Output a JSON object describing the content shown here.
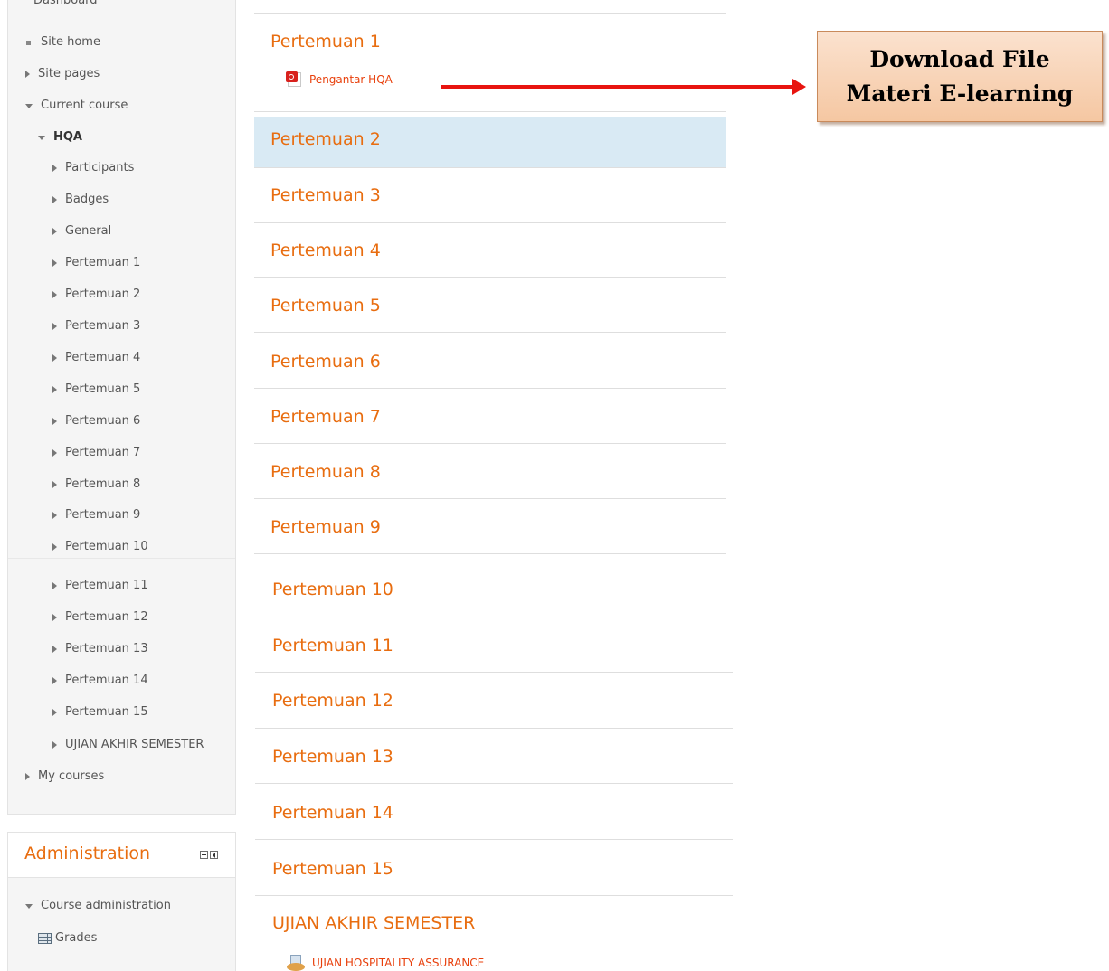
{
  "navigation": {
    "cut_item": "Dashboard",
    "items": [
      {
        "label": "Site home",
        "marker": "bullet",
        "bold": false
      },
      {
        "label": "Site pages",
        "marker": "collapsed",
        "bold": false
      },
      {
        "label": "Current course",
        "marker": "expanded",
        "bold": false
      },
      {
        "label": "HQA",
        "marker": "expanded",
        "bold": true
      },
      {
        "label": "Participants",
        "marker": "collapsed",
        "bold": false
      },
      {
        "label": "Badges",
        "marker": "collapsed",
        "bold": false
      },
      {
        "label": "General",
        "marker": "collapsed",
        "bold": false
      },
      {
        "label": "Pertemuan 1",
        "marker": "collapsed",
        "bold": false
      },
      {
        "label": "Pertemuan 2",
        "marker": "collapsed",
        "bold": false
      },
      {
        "label": "Pertemuan 3",
        "marker": "collapsed",
        "bold": false
      },
      {
        "label": "Pertemuan 4",
        "marker": "collapsed",
        "bold": false
      },
      {
        "label": "Pertemuan 5",
        "marker": "collapsed",
        "bold": false
      },
      {
        "label": "Pertemuan 6",
        "marker": "collapsed",
        "bold": false
      },
      {
        "label": "Pertemuan 7",
        "marker": "collapsed",
        "bold": false
      },
      {
        "label": "Pertemuan 8",
        "marker": "collapsed",
        "bold": false
      },
      {
        "label": "Pertemuan 9",
        "marker": "collapsed",
        "bold": false
      },
      {
        "label": "Pertemuan 10",
        "marker": "collapsed",
        "bold": false
      },
      {
        "label": "Pertemuan 11",
        "marker": "collapsed",
        "bold": false
      },
      {
        "label": "Pertemuan 12",
        "marker": "collapsed",
        "bold": false
      },
      {
        "label": "Pertemuan 13",
        "marker": "collapsed",
        "bold": false
      },
      {
        "label": "Pertemuan 14",
        "marker": "collapsed",
        "bold": false
      },
      {
        "label": "Pertemuan 15",
        "marker": "collapsed",
        "bold": false
      },
      {
        "label": "UJIAN AKHIR SEMESTER",
        "marker": "collapsed",
        "bold": false
      },
      {
        "label": "My courses",
        "marker": "collapsed",
        "bold": false
      }
    ]
  },
  "administration": {
    "title": "Administration",
    "items": [
      {
        "label": "Course administration",
        "marker": "expanded"
      },
      {
        "label": "Grades",
        "marker": "grid-icon"
      }
    ]
  },
  "sections": [
    {
      "title": "Pertemuan 1",
      "highlighted": false,
      "activity": {
        "label": "Pengantar HQA",
        "icon": "pdf-icon"
      }
    },
    {
      "title": "Pertemuan 2",
      "highlighted": true
    },
    {
      "title": "Pertemuan 3",
      "highlighted": false
    },
    {
      "title": "Pertemuan 4",
      "highlighted": false
    },
    {
      "title": "Pertemuan 5",
      "highlighted": false
    },
    {
      "title": "Pertemuan 6",
      "highlighted": false
    },
    {
      "title": "Pertemuan 7",
      "highlighted": false
    },
    {
      "title": "Pertemuan 8",
      "highlighted": false
    },
    {
      "title": "Pertemuan 9",
      "highlighted": false
    },
    {
      "title": "Pertemuan 10",
      "highlighted": false
    },
    {
      "title": "Pertemuan 11",
      "highlighted": false
    },
    {
      "title": "Pertemuan 12",
      "highlighted": false
    },
    {
      "title": "Pertemuan 13",
      "highlighted": false
    },
    {
      "title": "Pertemuan 14",
      "highlighted": false
    },
    {
      "title": "Pertemuan 15",
      "highlighted": false
    },
    {
      "title": "UJIAN AKHIR SEMESTER",
      "highlighted": false,
      "activity": {
        "label": "UJIAN HOSPITALITY ASSURANCE",
        "icon": "quiz-icon"
      }
    }
  ],
  "callout": {
    "line1": "Download File",
    "line2": "Materi E-learning"
  },
  "colors": {
    "section_title": "#e86d10",
    "activity_link": "#e8400c",
    "highlight": "#d9eaf4",
    "arrow": "#e8140f",
    "callout_fill": "#f5c7a2"
  }
}
